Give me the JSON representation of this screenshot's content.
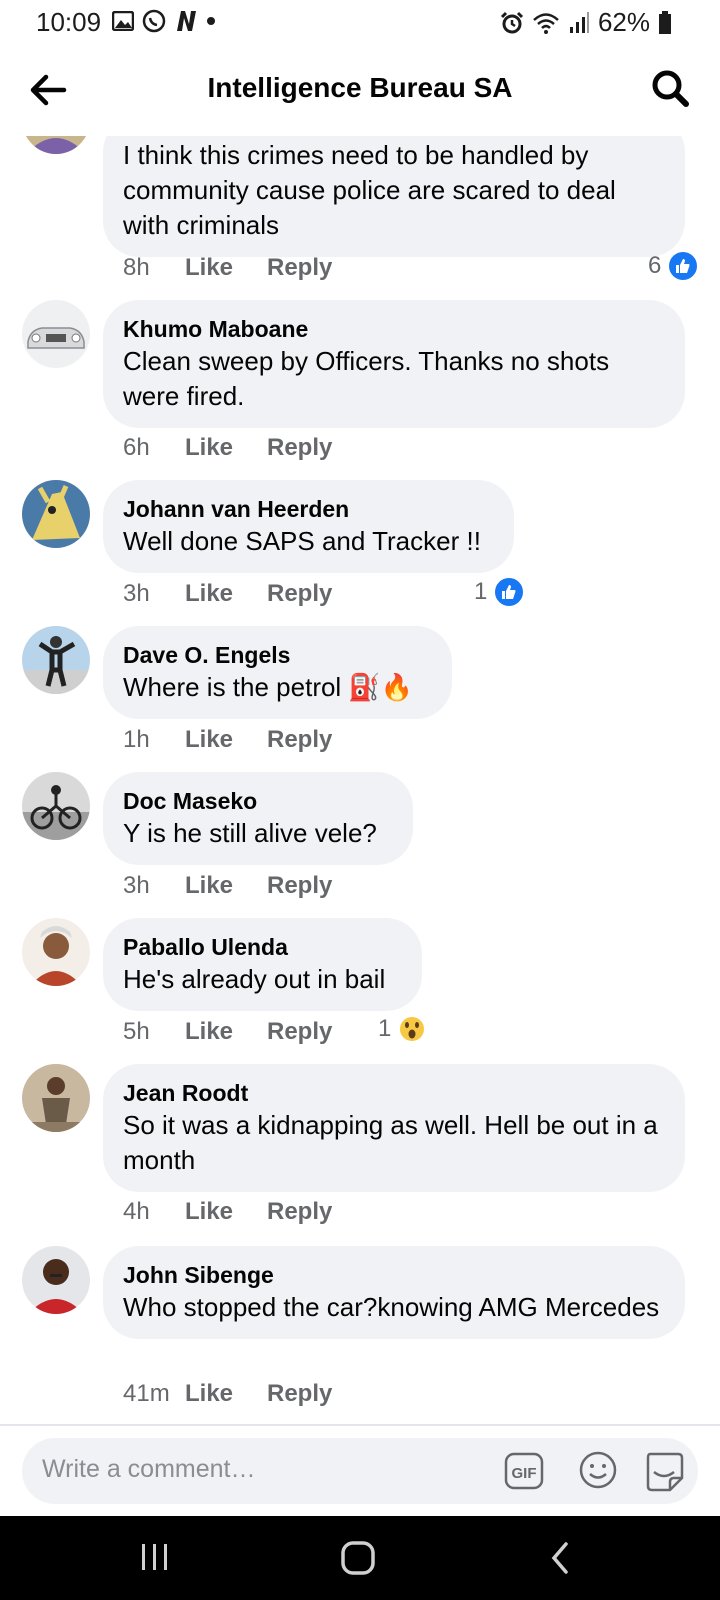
{
  "status": {
    "time": "10:09",
    "battery": "62%"
  },
  "header": {
    "title": "Intelligence Bureau SA"
  },
  "comments": [
    {
      "author": "",
      "text": "I think this crimes need to be handled by community cause police are scared to deal with criminals",
      "time": "8h",
      "like": "Like",
      "reply": "Reply",
      "reaction_count": "6"
    },
    {
      "author": "Khumo Maboane",
      "text": "Clean sweep by Officers. Thanks no shots were fired.",
      "time": "6h",
      "like": "Like",
      "reply": "Reply"
    },
    {
      "author": "Johann van Heerden",
      "text": "Well done SAPS and Tracker !!",
      "time": "3h",
      "like": "Like",
      "reply": "Reply",
      "reaction_count": "1"
    },
    {
      "author": "Dave O. Engels",
      "text": "Where is the petrol ⛽🔥",
      "time": "1h",
      "like": "Like",
      "reply": "Reply"
    },
    {
      "author": "Doc Maseko",
      "text": "Y is he still alive vele?",
      "time": "3h",
      "like": "Like",
      "reply": "Reply"
    },
    {
      "author": "Paballo Ulenda",
      "text": "He's already out in bail",
      "time": "5h",
      "like": "Like",
      "reply": "Reply",
      "reaction_count": "1"
    },
    {
      "author": "Jean Roodt",
      "text": "So it was a kidnapping as well. Hell be out in a month",
      "time": "4h",
      "like": "Like",
      "reply": "Reply"
    },
    {
      "author": "John Sibenge",
      "text": "Who stopped the car?knowing AMG Mercedes",
      "time": "41m",
      "like": "Like",
      "reply": "Reply"
    }
  ],
  "composer": {
    "placeholder": "Write a comment…",
    "gif_label": "GIF"
  },
  "icons": {
    "like_reaction": "thumbs-up-icon",
    "wow_reaction": "wow-face-icon",
    "back": "arrow-left-icon",
    "search": "search-icon"
  },
  "colors": {
    "like_blue": "#1877f2",
    "bubble": "#f0f2f5",
    "meta": "#65676b"
  }
}
